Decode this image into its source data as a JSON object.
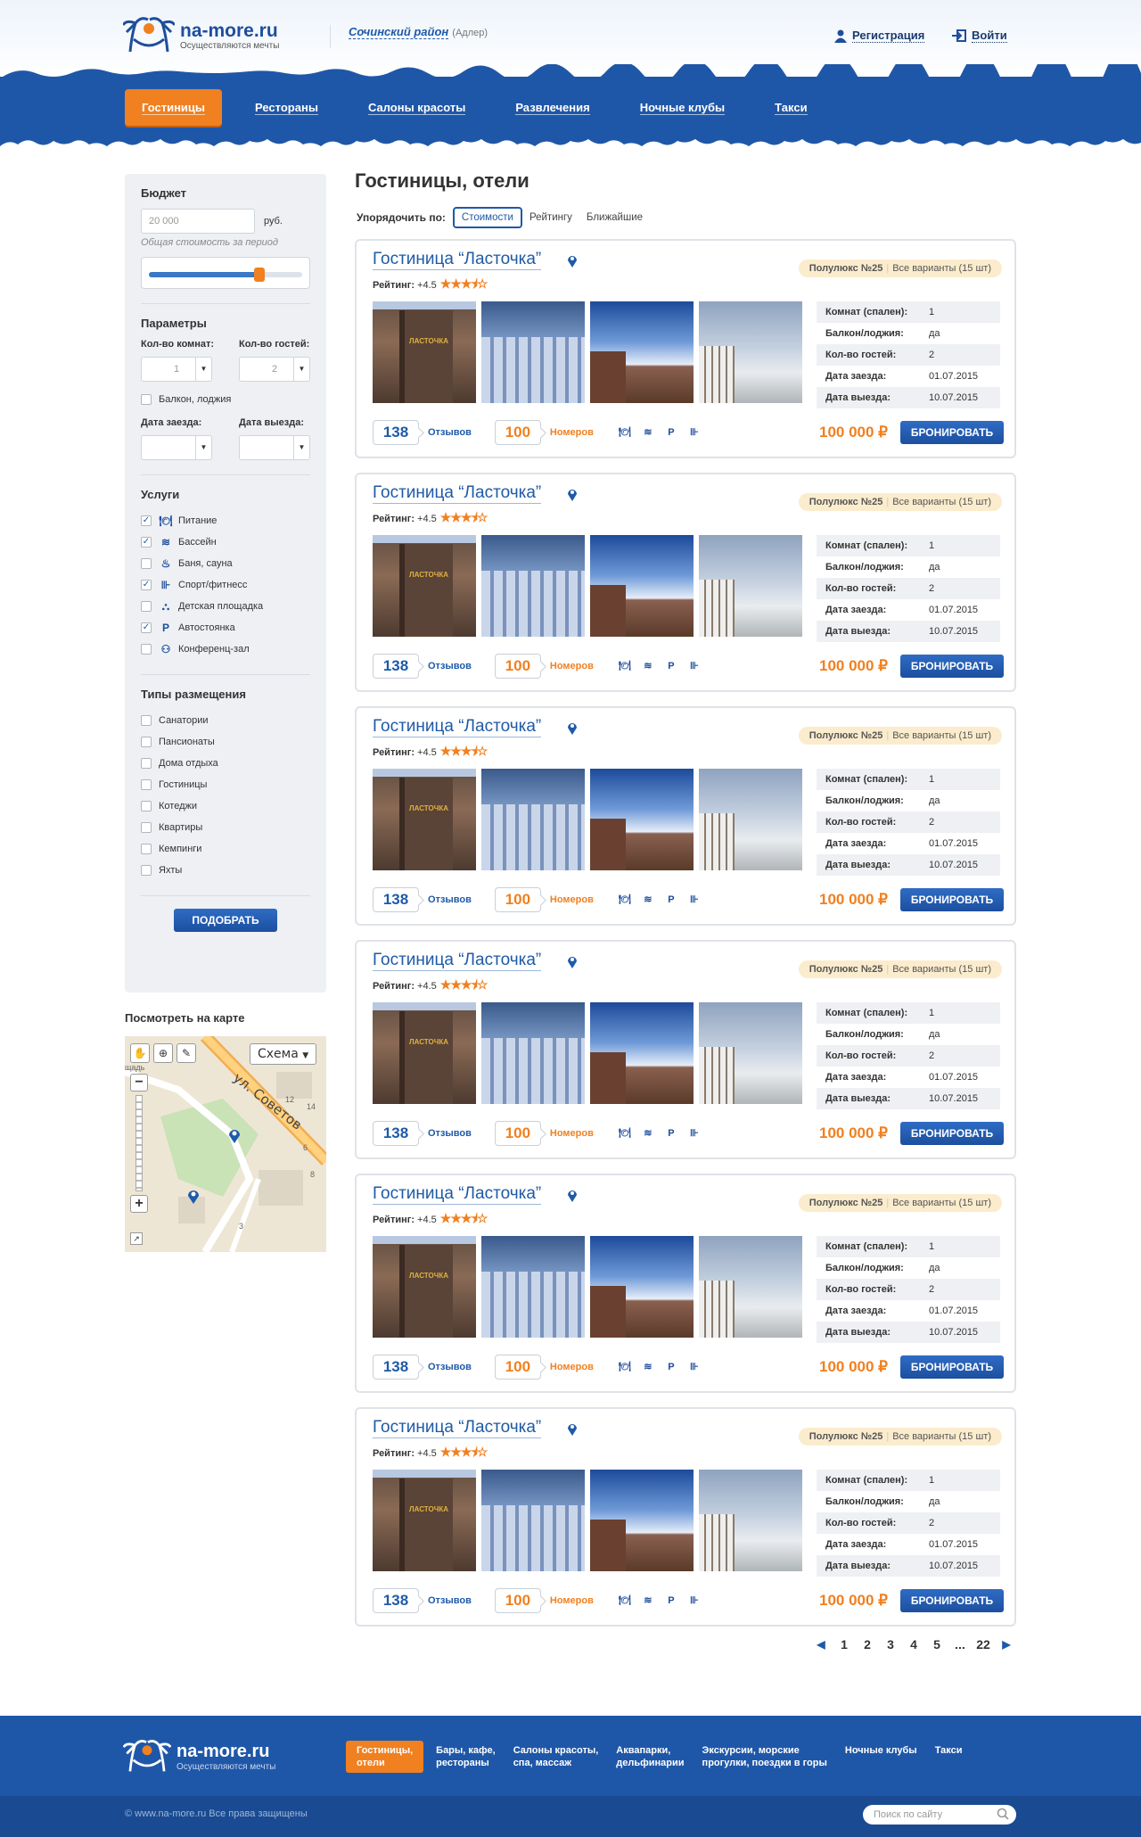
{
  "header": {
    "logo_name": "na-more.ru",
    "logo_slogan": "Осуществляются мечты",
    "region": "Сочинский район",
    "region_sub": "(Адлер)",
    "register": "Регистрация",
    "login": "Войти"
  },
  "nav": [
    "Гостиницы",
    "Рестораны",
    "Салоны красоты",
    "Развлечения",
    "Ночные клубы",
    "Такси"
  ],
  "sidebar": {
    "budget_title": "Бюджет",
    "budget_placeholder": "20 000",
    "budget_currency": "руб.",
    "budget_hint": "Общая стоимость за период",
    "budget_slider_level": 0.72,
    "params_title": "Параметры",
    "rooms_label": "Кол-во комнат:",
    "rooms_value": "1",
    "guests_label": "Кол-во гостей:",
    "guests_value": "2",
    "balcony_label": "Балкон, лоджия",
    "checkin_label": "Дата заезда:",
    "checkout_label": "Дата выезда:",
    "services_title": "Услуги",
    "services": [
      {
        "label": "Питание",
        "checked": true,
        "icon": "food-icon"
      },
      {
        "label": "Бассейн",
        "checked": true,
        "icon": "pool-icon"
      },
      {
        "label": "Баня, сауна",
        "checked": false,
        "icon": "sauna-icon"
      },
      {
        "label": "Спорт/фитнесс",
        "checked": true,
        "icon": "fitness-icon"
      },
      {
        "label": "Детская площадка",
        "checked": false,
        "icon": "playground-icon"
      },
      {
        "label": "Автостоянка",
        "checked": true,
        "icon": "parking-icon"
      },
      {
        "label": "Конференц-зал",
        "checked": false,
        "icon": "conference-icon"
      }
    ],
    "types_title": "Типы размещения",
    "types": [
      "Санатории",
      "Пансионаты",
      "Дома отдыха",
      "Гостиницы",
      "Котеджи",
      "Квартиры",
      "Кемпинги",
      "Яхты"
    ],
    "submit": "ПОДОБРАТЬ"
  },
  "map": {
    "title": "Посмотреть на карте",
    "scheme": "Схема",
    "street": "ул. Советов",
    "numbers": [
      "12",
      "14",
      "8",
      "3",
      "6"
    ],
    "street_cut": "щадь"
  },
  "main": {
    "title": "Гостиницы, отели",
    "sort_label": "Упорядочить по:",
    "sort_options": [
      "Стоимости",
      "Рейтингу",
      "Ближайшие"
    ],
    "sort_active": 0
  },
  "hotel": {
    "name": "Гостиница “Ласточка”",
    "rating_label": "Рейтинг:",
    "rating_value": "+4.5",
    "stars": 3.5,
    "lux": "Полулюкс №25",
    "variants": "Все варианты (15 шт)",
    "props": [
      {
        "k": "Комнат (спален):",
        "v": "1"
      },
      {
        "k": "Балкон/лоджия:",
        "v": "да"
      },
      {
        "k": "Кол-во гостей:",
        "v": "2"
      },
      {
        "k": "Дата заезда:",
        "v": "01.07.2015"
      },
      {
        "k": "Дата выезда:",
        "v": "10.07.2015"
      }
    ],
    "reviews_count": "138",
    "reviews_label": "Отзывов",
    "rooms_count": "100",
    "rooms_label": "Номеров",
    "services": [
      "food-icon",
      "pool-icon",
      "parking-icon",
      "fitness-icon"
    ],
    "price": "100 000 ₽",
    "book": "БРОНИРОВАТЬ",
    "photo_sign": "ЛАСТОЧКА"
  },
  "pager": [
    "1",
    "2",
    "3",
    "4",
    "5",
    "...",
    "22"
  ],
  "footer": {
    "logo_name": "na-more.ru",
    "logo_slogan": "Осуществляются мечты",
    "nav": [
      [
        "Гостиницы,",
        "отели"
      ],
      [
        "Бары, кафе,",
        "рестораны"
      ],
      [
        "Салоны красоты,",
        "спа, массаж"
      ],
      [
        "Аквапарки,",
        "дельфинарии"
      ],
      [
        "Экскурсии, морские",
        "прогулки, поездки в горы"
      ],
      [
        "Ночные клубы",
        ""
      ],
      [
        "Такси",
        ""
      ]
    ],
    "copyright": "© www.na-more.ru Все права защищены",
    "search_placeholder": "Поиск по сайту"
  },
  "colors": {
    "brand_blue": "#1f57a8",
    "accent_orange": "#f08020",
    "link_blue": "#1e5aa8"
  }
}
